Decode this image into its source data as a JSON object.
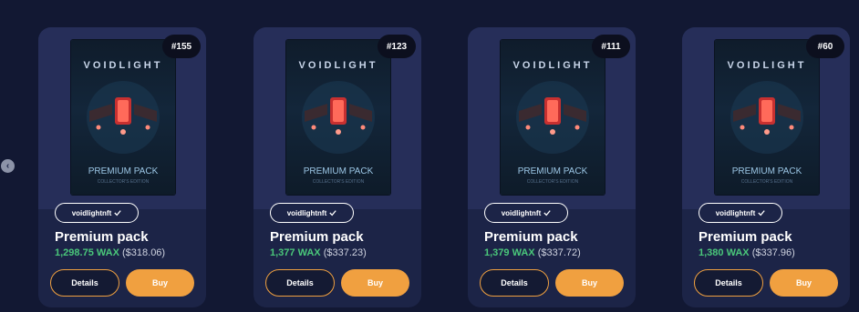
{
  "nav": {
    "prev_glyph": "‹"
  },
  "cards": [
    {
      "edition": "#155",
      "pack_title": "VOIDLIGHT",
      "pack_label": "PREMIUM PACK",
      "pack_small": "COLLECTOR'S EDITION",
      "collection": "voidlightnft",
      "name": "Premium pack",
      "price_wax": "1,298.75 WAX",
      "price_usd": "($318.06)",
      "details_label": "Details",
      "buy_label": "Buy"
    },
    {
      "edition": "#123",
      "pack_title": "VOIDLIGHT",
      "pack_label": "PREMIUM PACK",
      "pack_small": "COLLECTOR'S EDITION",
      "collection": "voidlightnft",
      "name": "Premium pack",
      "price_wax": "1,377 WAX",
      "price_usd": "($337.23)",
      "details_label": "Details",
      "buy_label": "Buy"
    },
    {
      "edition": "#111",
      "pack_title": "VOIDLIGHT",
      "pack_label": "PREMIUM PACK",
      "pack_small": "COLLECTOR'S EDITION",
      "collection": "voidlightnft",
      "name": "Premium pack",
      "price_wax": "1,379 WAX",
      "price_usd": "($337.72)",
      "details_label": "Details",
      "buy_label": "Buy"
    },
    {
      "edition": "#60",
      "pack_title": "VOIDLIGHT",
      "pack_label": "PREMIUM PACK",
      "pack_small": "COLLECTOR'S EDITION",
      "collection": "voidlightnft",
      "name": "Premium pack",
      "price_wax": "1,380 WAX",
      "price_usd": "($337.96)",
      "details_label": "Details",
      "buy_label": "Buy"
    }
  ],
  "colors": {
    "background": "#121833",
    "card": "#1c2447",
    "accent": "#f0a040",
    "price_green": "#4ac77a"
  },
  "icons": [
    "verified-check-icon",
    "chevron-left-icon",
    "drone-art"
  ]
}
